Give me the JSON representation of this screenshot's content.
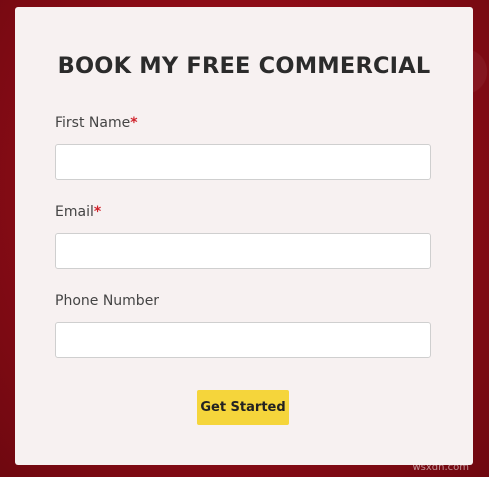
{
  "form": {
    "title": "BOOK MY FREE COMMERCIAL",
    "fields": [
      {
        "label": "First Name",
        "required_marker": "*",
        "value": "",
        "placeholder": ""
      },
      {
        "label": "Email",
        "required_marker": "*",
        "value": "",
        "placeholder": ""
      },
      {
        "label": "Phone Number",
        "required_marker": "",
        "value": "",
        "placeholder": ""
      }
    ],
    "submit_label": "Get Started"
  },
  "watermark": "wsxdn.com",
  "colors": {
    "background": "#8a0c16",
    "card": "#f7f1f1",
    "button": "#f5d53b",
    "required": "#d0222b"
  }
}
